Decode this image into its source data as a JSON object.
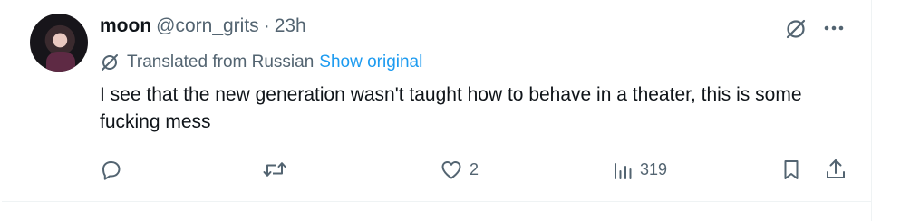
{
  "tweet": {
    "author_name": "moon",
    "handle": "@corn_grits",
    "separator": "·",
    "time": "23h",
    "translation_label": "Translated from Russian",
    "show_original_label": "Show original",
    "text": "I see that the new generation wasn't taught how to behave in a theater, this is some fucking mess"
  },
  "actions": {
    "reply_count": "",
    "retweet_count": "",
    "like_count": "2",
    "view_count": "319"
  },
  "icons": {
    "grok": "grok-icon",
    "more": "more-icon",
    "translate": "translate-icon",
    "reply": "reply-icon",
    "retweet": "retweet-icon",
    "like": "heart-icon",
    "views": "views-icon",
    "bookmark": "bookmark-icon",
    "share": "share-icon"
  },
  "colors": {
    "text": "#0f1419",
    "secondary": "#536471",
    "link": "#1d9bf0",
    "border": "#eff3f4"
  }
}
